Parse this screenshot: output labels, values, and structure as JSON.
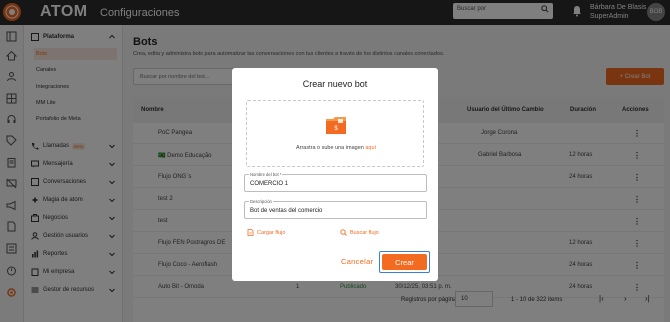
{
  "topbar": {
    "brand": "ATOM",
    "section": "Configuraciones",
    "search_placeholder": "Buscar por",
    "user_name": "Bárbara De Blasis",
    "user_role": "SuperAdmin",
    "avatar_initials": "BOB"
  },
  "menu": {
    "platform": "Plataforma",
    "sub_items": [
      "Bots",
      "Canales",
      "Integraciones",
      "MM Lite",
      "Portafolio de Meta"
    ],
    "items": [
      "Llamadas",
      "Mensajería",
      "Conversaciones",
      "Magia de atom",
      "Negocios",
      "Gestión usuarios",
      "Reportes",
      "Mi empresa",
      "Gestor de recursos"
    ],
    "beta_label": "Beta"
  },
  "page": {
    "title": "Bots",
    "subtitle": "Crea, edita y administra bots para automatizar las conversaciones con tus clientes a través de los distintos canales conectados.",
    "search_placeholder": "Buscar por nombre del bot...",
    "create_button": "+ Crear Bot"
  },
  "table": {
    "headers": {
      "name": "Nombre",
      "last_user": "Usuario del Último Cambio",
      "duration": "Duración",
      "actions": "Acciones"
    },
    "rows": [
      {
        "name": "PoC Pangea",
        "user": "Jorge Corona",
        "duration": ""
      },
      {
        "name": "🇧🇷 Demo Educação",
        "user": "Gabriel Barbosa",
        "duration": "12 horas"
      },
      {
        "name": "Flujo ONG´s",
        "user": "",
        "duration": "24 horas"
      },
      {
        "name": "test 2",
        "user": "",
        "duration": ""
      },
      {
        "name": "test",
        "user": "",
        "duration": ""
      },
      {
        "name": "Flujo FEN Postragros DE",
        "user": "",
        "duration": "12 horas"
      },
      {
        "name": "Flujo Coco - Aeroflash",
        "user": "",
        "duration": "24 horas"
      },
      {
        "name": "Auto Bit - Omoda",
        "user": "",
        "duration": "24 horas"
      }
    ],
    "partial_row": {
      "count": "1",
      "status": "Publicado",
      "date": "30/12/25, 03:51 p. m."
    },
    "footer": {
      "rows_label": "Registros por página",
      "rows_value": "10",
      "range": "1 - 10 de 322 items"
    }
  },
  "modal": {
    "title": "Crear nuevo bot",
    "drop_text": "Arrastra o sube una imagen",
    "drop_link": "aquí",
    "name_label": "Nombre del bot *",
    "name_value": "COMERCIO 1",
    "desc_label": "Descripción",
    "desc_value": "Bot de ventas del comercio",
    "load_flow": "Cargar flujo",
    "search_flow": "Buscar flujo",
    "cancel": "Cancelar",
    "create": "Crear"
  },
  "colors": {
    "accent": "#f36b21",
    "focus": "#3b7ddd",
    "topbar": "#2d2d2d"
  }
}
